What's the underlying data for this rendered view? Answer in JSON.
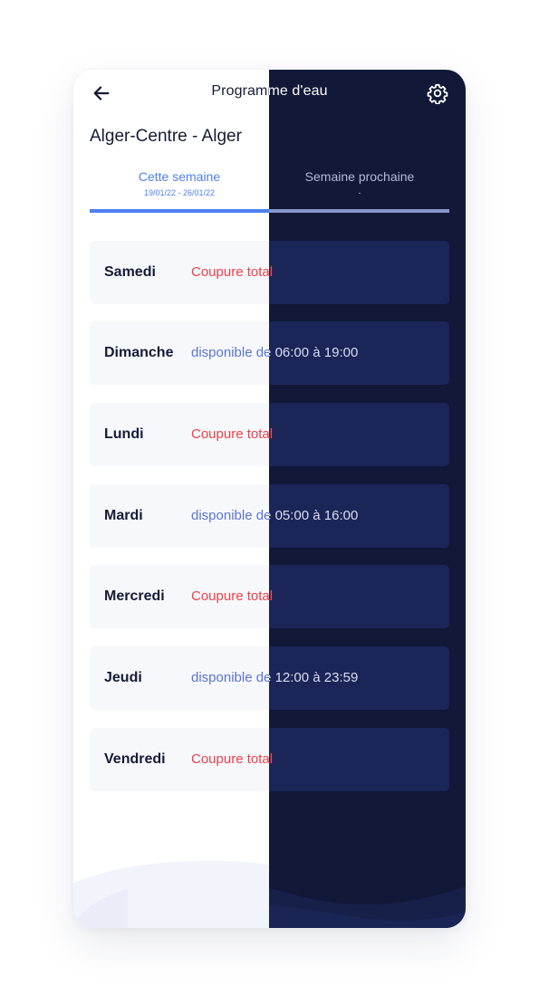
{
  "header": {
    "title": "Programme d'eau"
  },
  "location": "Alger-Centre - Alger",
  "tabs": [
    {
      "label": "Cette semaine",
      "dates": "19/01/22 - 26/01/22"
    },
    {
      "label": "Semaine prochaine",
      "dates": "-"
    }
  ],
  "days": [
    {
      "name": "Samedi",
      "status": "Coupure total",
      "state": "cut"
    },
    {
      "name": "Dimanche",
      "status": "disponible de 06:00 à 19:00",
      "state": "available"
    },
    {
      "name": "Lundi",
      "status": "Coupure total",
      "state": "cut"
    },
    {
      "name": "Mardi",
      "status": "disponible de 05:00 à 16:00",
      "state": "available"
    },
    {
      "name": "Mercredi",
      "status": "Coupure total",
      "state": "cut"
    },
    {
      "name": "Jeudi",
      "status": "disponible de 12:00 à 23:59",
      "state": "available"
    },
    {
      "name": "Vendredi",
      "status": "Coupure total",
      "state": "cut"
    }
  ],
  "icons": {
    "back": "arrow-left-icon",
    "settings": "gear-icon"
  },
  "colors": {
    "accent": "#4d7ff0",
    "cut": "#ef4048",
    "available": "#5a74d6",
    "dark_background": "#111838"
  }
}
